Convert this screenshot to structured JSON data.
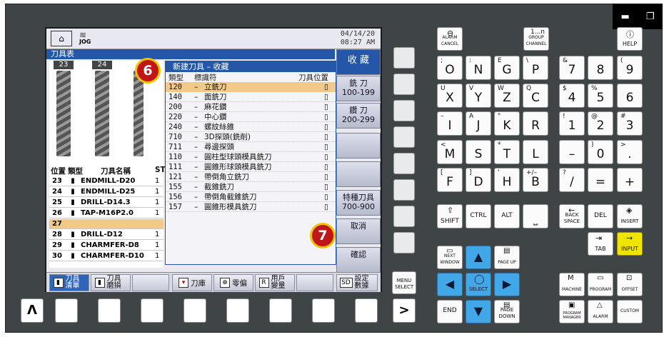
{
  "header": {
    "date": "04/14/20",
    "time": "08:27 AM",
    "mode": "JOG"
  },
  "title_bar": "刀具表",
  "right_softkeys": [
    {
      "label": "收 藏"
    },
    {
      "label": "銑 刀\n100-199"
    },
    {
      "label": "鑽 刀\n200-299"
    },
    {
      "label": ""
    },
    {
      "label": ""
    },
    {
      "label": "特種刀具\n700-900"
    },
    {
      "label": "取消"
    },
    {
      "label": "確認"
    }
  ],
  "tool_positions": [
    "23",
    "24"
  ],
  "tool_table": {
    "columns": [
      "位置",
      "類型",
      "刀具名稱",
      "ST"
    ],
    "rows": [
      {
        "pos": "23",
        "name": "ENDMILL-D20",
        "st": "1"
      },
      {
        "pos": "24",
        "name": "ENDMILL-D25",
        "st": "1"
      },
      {
        "pos": "25",
        "name": "DRILL-D14.3",
        "st": "1"
      },
      {
        "pos": "26",
        "name": "TAP-M16P2.0",
        "st": "1"
      },
      {
        "pos": "27",
        "name": "",
        "st": ""
      },
      {
        "pos": "28",
        "name": "DRILL-D12",
        "st": "1"
      },
      {
        "pos": "29",
        "name": "CHARMFER-D8",
        "st": "1"
      },
      {
        "pos": "30",
        "name": "CHARMFER-D10",
        "st": "1"
      }
    ]
  },
  "popup": {
    "title": "新建刀具 – 收藏",
    "col_type": "類型",
    "col_id": "標識符",
    "col_pos": "刀具位置",
    "rows": [
      {
        "code": "120",
        "label": "立銑刀"
      },
      {
        "code": "140",
        "label": "面銑刀"
      },
      {
        "code": "200",
        "label": "麻花鑽"
      },
      {
        "code": "220",
        "label": "中心鑽"
      },
      {
        "code": "240",
        "label": "螺紋絲錐"
      },
      {
        "code": "710",
        "label": "3D探頭(銑削)"
      },
      {
        "code": "711",
        "label": "尋邊探頭"
      },
      {
        "code": "110",
        "label": "圓柱型球頭模具銑刀"
      },
      {
        "code": "111",
        "label": "圓錐形球頭模具銑刀"
      },
      {
        "code": "121",
        "label": "帶倒角立銑刀"
      },
      {
        "code": "155",
        "label": "截錐銑刀"
      },
      {
        "code": "156",
        "label": "帶倒角截錐銑刀"
      },
      {
        "code": "157",
        "label": "圓錐形模具銑刀"
      }
    ]
  },
  "bottom_softkeys": [
    "刀具清單",
    "刀具磨損",
    "刀庫",
    "零偏",
    "用戶變量",
    "設定數據"
  ],
  "badges": [
    "6",
    "7"
  ],
  "keypad": {
    "alarm_cancel": "ALARM CANCEL",
    "group_channel": "GROUP CHANNEL",
    "group_channel_top": "1...n",
    "help": "HELP",
    "menu_select": "MENU SELECT",
    "shift": "SHIFT",
    "ctrl": "CTRL",
    "alt": "ALT",
    "back_space": "BACK SPACE",
    "del": "DEL",
    "insert": "INSERT",
    "tab": "TAB",
    "input": "INPUT",
    "next_window": "NEXT WINDOW",
    "page_up": "PAGE UP",
    "page_down": "PAGE DOWN",
    "select": "SELECT",
    "end": "END",
    "machine": "MACHINE",
    "program": "PROGRAM",
    "offset": "OFFSET",
    "program_manager": "PROGRAM MANAGER",
    "alarm": "ALARM",
    "custom": "CUSTOM",
    "rows": [
      [
        {
          "sup": ";",
          "main": "O"
        },
        {
          "sup": ":",
          "main": "N"
        },
        {
          "sup": "E",
          "main": "G"
        },
        {
          "sup": "\\",
          "main": "P"
        },
        {
          "sup": "&",
          "main": "7"
        },
        {
          "sup": "",
          "main": "8"
        },
        {
          "sup": "(",
          "main": "9"
        }
      ],
      [
        {
          "sup": "U",
          "main": "X"
        },
        {
          "sup": "V",
          "main": "Y"
        },
        {
          "sup": "W",
          "main": "Z"
        },
        {
          "sup": "Q",
          "main": "C"
        },
        {
          "sup": "$",
          "main": "4"
        },
        {
          "sup": "%",
          "main": "5"
        },
        {
          "sup": "",
          "main": "6"
        }
      ],
      [
        {
          "sup": "–",
          "main": "I"
        },
        {
          "sup": "A",
          "main": "J"
        },
        {
          "sup": "\"",
          "main": "K"
        },
        {
          "sup": "",
          "main": "R"
        },
        {
          "sup": "!",
          "main": "1"
        },
        {
          "sup": "@",
          "main": "2"
        },
        {
          "sup": "#",
          "main": "3"
        }
      ],
      [
        {
          "sup": "<",
          "main": "M"
        },
        {
          "sup": "",
          "main": "S"
        },
        {
          "sup": "*",
          "main": "T"
        },
        {
          "sup": "",
          "main": "L"
        },
        {
          "sup": "",
          "main": "–"
        },
        {
          "sup": ")",
          "main": "0"
        },
        {
          "sup": ">",
          "main": "."
        }
      ],
      [
        {
          "sup": "[",
          "main": "F"
        },
        {
          "sup": "]",
          "main": "D"
        },
        {
          "sup": "'",
          "main": "H"
        },
        {
          "sup": "+/–",
          "main": "B"
        },
        {
          "sup": "?",
          "main": "/"
        },
        {
          "sup": "",
          "main": "="
        },
        {
          "sup": "",
          "main": "+"
        }
      ]
    ]
  },
  "bottom_row": {
    "left_arrow": "Λ",
    "right_arrow": ">"
  }
}
